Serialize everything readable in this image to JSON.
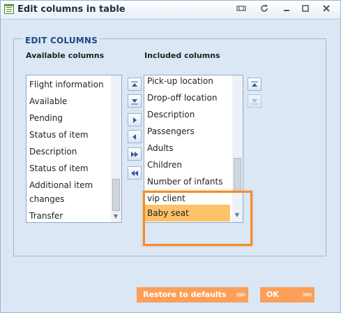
{
  "window": {
    "title": "Edit columns in table",
    "controls": [
      "pin-icon",
      "refresh-icon",
      "minimize-icon",
      "maximize-icon",
      "close-icon"
    ]
  },
  "panel": {
    "legend": "EDIT COLUMNS",
    "available_header": "Available columns",
    "included_header": "Included columns",
    "available_items": [
      "Flight information",
      "Available",
      "Pending",
      "Status of item",
      "Description",
      "Status of item",
      "Additional item",
      "changes",
      "Transfer"
    ],
    "included_items": [
      "Pick-up location",
      "Drop-off location",
      "Description",
      "Passengers",
      "Adults",
      "Children",
      "Number of infants",
      "vip client",
      "Baby seat"
    ],
    "selected_included": "Baby seat"
  },
  "footer": {
    "restore_label": "Restore to defaults",
    "ok_label": "OK"
  },
  "colors": {
    "accent": "#f28c2e",
    "selection": "#fec26a",
    "button_orange": "#fb9f59",
    "panel_bg": "#dbe7f5"
  }
}
